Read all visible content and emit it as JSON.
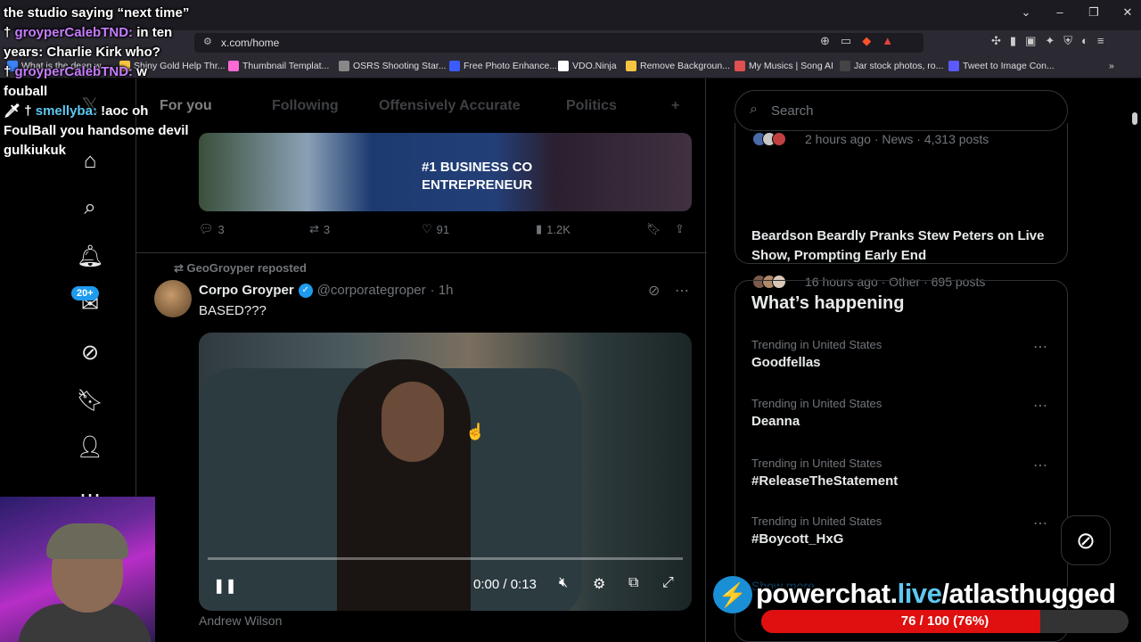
{
  "browser": {
    "url": "x.com/home",
    "bookmarks": [
      {
        "label": "What is the deep w...",
        "color": "#3b82f6"
      },
      {
        "label": "Shiny Gold Help Thr...",
        "color": "#f5c542"
      },
      {
        "label": "Thumbnail Templat...",
        "color": "#ff6ad5"
      },
      {
        "label": "OSRS Shooting Star...",
        "color": "#888888"
      },
      {
        "label": "Free Photo Enhance...",
        "color": "#3b5bff"
      },
      {
        "label": "VDO.Ninja",
        "color": "#ffffff"
      },
      {
        "label": "Remove Backgroun...",
        "color": "#f5c542"
      },
      {
        "label": "My Musics | Song AI",
        "color": "#e05050"
      },
      {
        "label": "Jar stock photos, ro...",
        "color": "#444444"
      },
      {
        "label": "Tweet to Image Con...",
        "color": "#5a5aff"
      }
    ]
  },
  "chat": [
    {
      "user": "",
      "msg": "the studio saying “next time”"
    },
    {
      "user": "groyperCalebTND:",
      "msg": "in ten years: Charlie Kirk who?"
    },
    {
      "user": "groyperCalebTND:",
      "msg": "w fouball"
    },
    {
      "user": "smellyba:",
      "msg": "!aoc oh FoulBall you handsome devil gulkiukuk"
    }
  ],
  "nav": {
    "badge": "20+"
  },
  "feed": {
    "tabs": [
      "For you",
      "Following",
      "Offensively Accurate",
      "Politics"
    ],
    "image_text": [
      "#1 BUSINESS CO",
      "ENTREPRENEUR"
    ],
    "prev_actions": {
      "replies": "3",
      "reposts": "3",
      "likes": "91",
      "views": "1.2K"
    },
    "tweet": {
      "reposted_by": "GeoGroyper reposted",
      "name": "Corpo Groyper",
      "handle": "@corporategroper",
      "time": "· 1h",
      "text": "BASED???",
      "video_time": "0:00 / 0:13",
      "video_progress": 0,
      "caption": "Andrew Wilson"
    }
  },
  "sidebar": {
    "search_placeholder": "Search",
    "news_top_meta": "2 hours ago · News · 4,313 posts",
    "news_title": "Beardson Beardly Pranks Stew Peters on Live Show, Prompting Early End",
    "news_meta": "16 hours ago · Other · 695 posts",
    "whats_happening": "What’s happening",
    "trends": [
      {
        "context": "Trending in United States",
        "name": "Goodfellas"
      },
      {
        "context": "Trending in United States",
        "name": "Deanna"
      },
      {
        "context": "Trending in United States",
        "name": "#ReleaseTheStatement"
      },
      {
        "context": "Trending in United States",
        "name": "#Boycott_HxG"
      }
    ],
    "show_more": "Show more"
  },
  "overlay": {
    "site_main": "powerchat.",
    "site_hl": "live",
    "site_path": "/atlasthugged",
    "goal_text": "76 / 100 (76%)",
    "goal_fraction": 0.76
  },
  "colors": {
    "accent": "#1d9bf0",
    "goal": "#e01010"
  }
}
